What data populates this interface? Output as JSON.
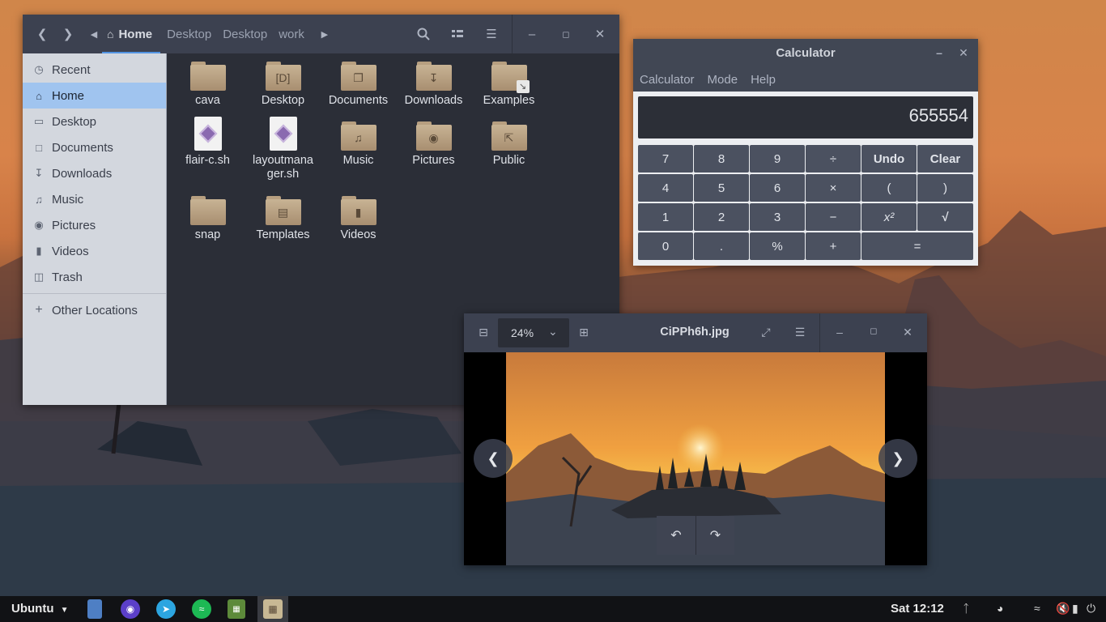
{
  "file_manager": {
    "breadcrumbs": [
      "Home",
      "Desktop",
      "Desktop",
      "work"
    ],
    "sidebar": {
      "items": [
        {
          "label": "Recent",
          "icon": "clock-icon"
        },
        {
          "label": "Home",
          "icon": "home-icon"
        },
        {
          "label": "Desktop",
          "icon": "folder-icon"
        },
        {
          "label": "Documents",
          "icon": "document-icon"
        },
        {
          "label": "Downloads",
          "icon": "download-icon"
        },
        {
          "label": "Music",
          "icon": "music-icon"
        },
        {
          "label": "Pictures",
          "icon": "camera-icon"
        },
        {
          "label": "Videos",
          "icon": "video-icon"
        },
        {
          "label": "Trash",
          "icon": "trash-icon"
        }
      ],
      "other": "Other Locations",
      "selected": "Home"
    },
    "files": [
      {
        "name": "cava",
        "type": "folder"
      },
      {
        "name": "Desktop",
        "type": "folder"
      },
      {
        "name": "Documents",
        "type": "folder"
      },
      {
        "name": "Downloads",
        "type": "folder"
      },
      {
        "name": "Examples",
        "type": "folder"
      },
      {
        "name": "flair-c.sh",
        "type": "script"
      },
      {
        "name": "layoutmanager.sh",
        "line1": "layoutmana",
        "line2": "ger.sh",
        "type": "script"
      },
      {
        "name": "Music",
        "type": "folder"
      },
      {
        "name": "Pictures",
        "type": "folder"
      },
      {
        "name": "Public",
        "type": "folder"
      },
      {
        "name": "snap",
        "type": "folder"
      },
      {
        "name": "Templates",
        "type": "folder"
      },
      {
        "name": "Videos",
        "type": "folder"
      }
    ]
  },
  "calculator": {
    "title": "Calculator",
    "menu": [
      "Calculator",
      "Mode",
      "Help"
    ],
    "display": "655554",
    "keys": [
      [
        "7",
        "8",
        "9",
        "÷",
        "Undo",
        "Clear"
      ],
      [
        "4",
        "5",
        "6",
        "×",
        "(",
        ")"
      ],
      [
        "1",
        "2",
        "3",
        "−",
        "x²",
        "√"
      ],
      [
        "0",
        ".",
        "%",
        "+",
        "="
      ]
    ]
  },
  "image_viewer": {
    "title": "CiPPh6h.jpg",
    "zoom": "24%"
  },
  "taskbar": {
    "start": "Ubuntu",
    "clock": "Sat 12:12"
  },
  "colors": {
    "accent": "#5294e2",
    "sidebar_selected": "#a0c4ef",
    "header": "#3c4150",
    "content_bg": "#2b2e37"
  }
}
